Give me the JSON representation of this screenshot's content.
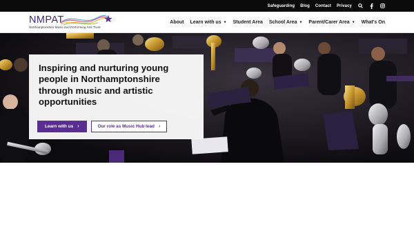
{
  "topbar": {
    "links": [
      "Safeguarding",
      "Blog",
      "Contact",
      "Privacy"
    ],
    "icons": [
      "search-icon",
      "facebook-icon",
      "instagram-icon"
    ]
  },
  "logo": {
    "wordmark": "NMPAT",
    "tagline": "Northamptonshire Music and Performing Arts Trust"
  },
  "nav": {
    "about": "About",
    "learn": "Learn with us",
    "student": "Student Area",
    "school": "School Area",
    "parent": "Parent/Carer Area",
    "whats_on": "What's On"
  },
  "hero": {
    "title": "Inspiring and nurturing young people in Northamptonshire through music and artistic opportunities",
    "primary_button": "Learn with us",
    "secondary_button": "Our role as Music Hub lead"
  },
  "colors": {
    "brand_purple": "#5a2d91",
    "topbar": "#0b0b0b"
  }
}
